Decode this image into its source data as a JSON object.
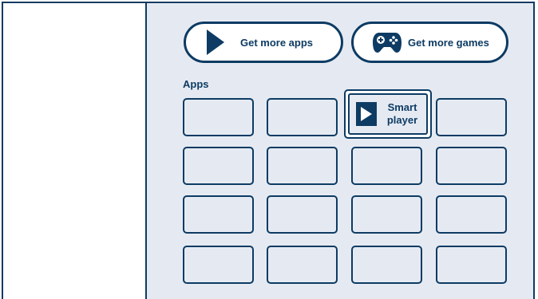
{
  "colors": {
    "accent": "#0d3b63",
    "content_bg": "#e5eaf2",
    "background": "#ffffff"
  },
  "buttons": {
    "get_apps": {
      "label": "Get more apps",
      "icon": "play-icon"
    },
    "get_games": {
      "label": "Get more games",
      "icon": "gamepad-icon"
    }
  },
  "apps_section": {
    "title": "Apps",
    "featured_app": {
      "label_line1": "Smart",
      "label_line2": "player",
      "icon": "play-icon"
    }
  }
}
